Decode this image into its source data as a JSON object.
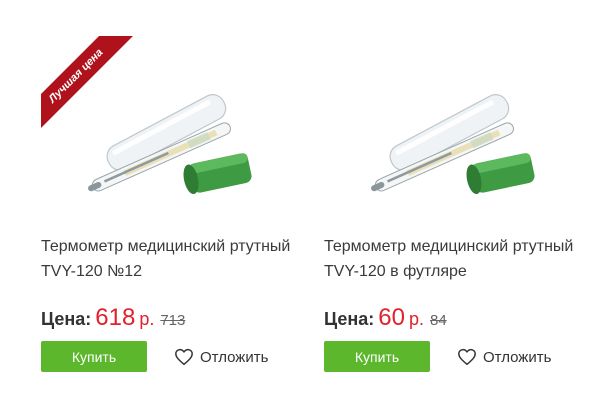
{
  "products": [
    {
      "badge": "Лучшая цена",
      "title_line1": "Термометр медицинский ртутный",
      "title_line2": "TVY-120 №12",
      "price_label": "Цена:",
      "price": "618",
      "currency": "р.",
      "old_price": "713",
      "buy_label": "Купить",
      "defer_label": "Отложить",
      "image_icon": "thermometer-image"
    },
    {
      "title_line1": "Термометр медицинский ртутный",
      "title_line2": "TVY-120 в футляре",
      "price_label": "Цена:",
      "price": "60",
      "currency": "р.",
      "old_price": "84",
      "buy_label": "Купить",
      "defer_label": "Отложить",
      "image_icon": "thermometer-image"
    }
  ],
  "colors": {
    "accent_green": "#5cb72c",
    "price_red": "#e3202b",
    "badge_red": "#b0121b"
  }
}
